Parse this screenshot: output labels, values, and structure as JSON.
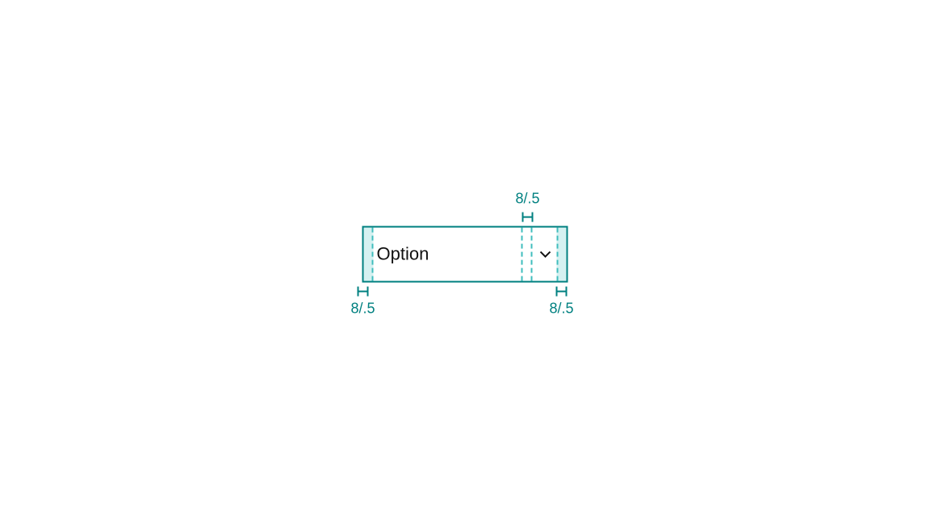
{
  "component": {
    "label": "Option",
    "icon_name": "chevron-down-icon"
  },
  "measurements": {
    "top_gap": "8/.5",
    "bottom_left": "8/.5",
    "bottom_right": "8/.5"
  },
  "colors": {
    "outline": "#008080",
    "guide": "#3fbdbd"
  }
}
